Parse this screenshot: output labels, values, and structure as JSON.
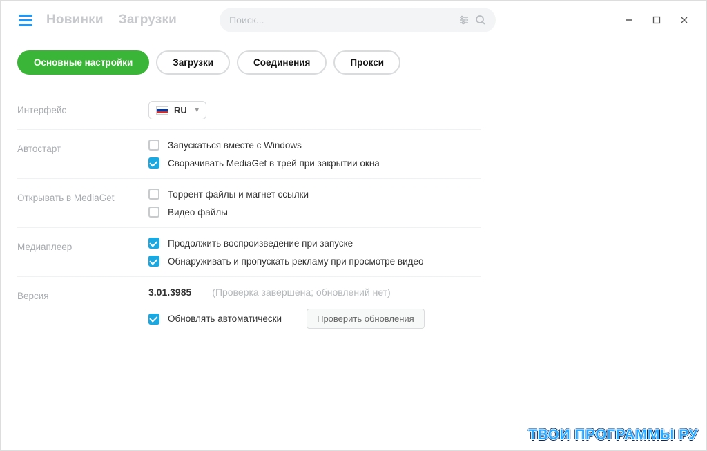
{
  "nav": {
    "new": "Новинки",
    "downloads": "Загрузки"
  },
  "search": {
    "placeholder": "Поиск..."
  },
  "tabs": [
    {
      "key": "main",
      "label": "Основные настройки",
      "active": true
    },
    {
      "key": "dl",
      "label": "Загрузки",
      "active": false
    },
    {
      "key": "conn",
      "label": "Соединения",
      "active": false
    },
    {
      "key": "proxy",
      "label": "Прокси",
      "active": false
    }
  ],
  "settings": {
    "interface": {
      "label": "Интерфейс",
      "lang_code": "RU"
    },
    "autostart": {
      "label": "Автостарт",
      "items": [
        {
          "checked": false,
          "text": "Запускаться вместе с Windows"
        },
        {
          "checked": true,
          "text": "Сворачивать MediaGet в трей при закрытии окна"
        }
      ]
    },
    "open_in": {
      "label": "Открывать в MediaGet",
      "items": [
        {
          "checked": false,
          "text": "Торрент файлы и магнет ссылки"
        },
        {
          "checked": false,
          "text": "Видео файлы"
        }
      ]
    },
    "player": {
      "label": "Медиаплеер",
      "items": [
        {
          "checked": true,
          "text": "Продолжить воспроизведение при запуске"
        },
        {
          "checked": true,
          "text": "Обнаруживать и пропускать рекламу при просмотре видео"
        }
      ]
    },
    "version": {
      "label": "Версия",
      "number": "3.01.3985",
      "status": "(Проверка завершена; обновлений нет)",
      "auto_update": {
        "checked": true,
        "text": "Обновлять автоматически"
      },
      "check_btn": "Проверить обновления"
    }
  },
  "watermark": "ТВОИ ПРОГРАММЫ РУ"
}
